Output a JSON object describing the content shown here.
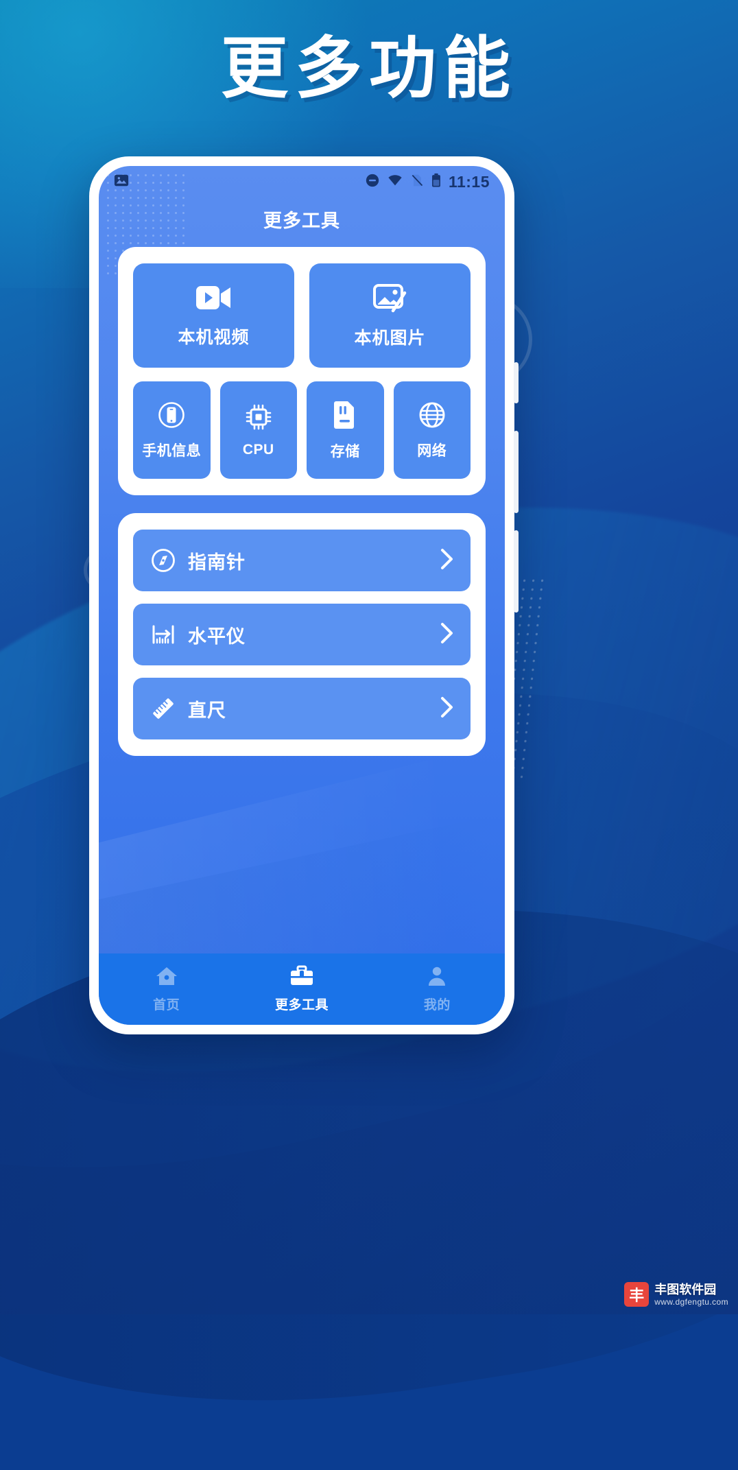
{
  "poster": {
    "headline": "更多功能",
    "accent_blue": "#1a73e8",
    "tile_blue": "#4f8cf0",
    "screen_blue": "#4f86ef"
  },
  "statusbar": {
    "photo_icon": "image-icon",
    "dnd_icon": "do-not-disturb-icon",
    "wifi_icon": "wifi-icon",
    "sim_icon": "no-sim-icon",
    "battery_icon": "battery-icon",
    "time": "11:15"
  },
  "header": {
    "title": "更多工具"
  },
  "grid_card": {
    "big_tiles": [
      {
        "label": "本机视频",
        "icon": "video-camera-icon"
      },
      {
        "label": "本机图片",
        "icon": "image-picture-icon"
      }
    ],
    "small_tiles": [
      {
        "label": "手机信息",
        "icon": "phone-info-icon"
      },
      {
        "label": "CPU",
        "icon": "cpu-chip-icon"
      },
      {
        "label": "存储",
        "icon": "sd-card-icon"
      },
      {
        "label": "网络",
        "icon": "globe-network-icon"
      }
    ]
  },
  "list_card": {
    "rows": [
      {
        "label": "指南针",
        "icon": "compass-icon",
        "chevron": "chevron-right-icon"
      },
      {
        "label": "水平仪",
        "icon": "spirit-level-icon",
        "chevron": "chevron-right-icon"
      },
      {
        "label": "直尺",
        "icon": "ruler-icon",
        "chevron": "chevron-right-icon"
      }
    ]
  },
  "bottom_nav": {
    "items": [
      {
        "label": "首页",
        "icon": "home-icon",
        "active": false
      },
      {
        "label": "更多工具",
        "icon": "toolbox-icon",
        "active": true
      },
      {
        "label": "我的",
        "icon": "person-icon",
        "active": false
      }
    ]
  },
  "watermark": {
    "badge": "丰",
    "name": "丰图软件园",
    "url": "www.dgfengtu.com"
  }
}
